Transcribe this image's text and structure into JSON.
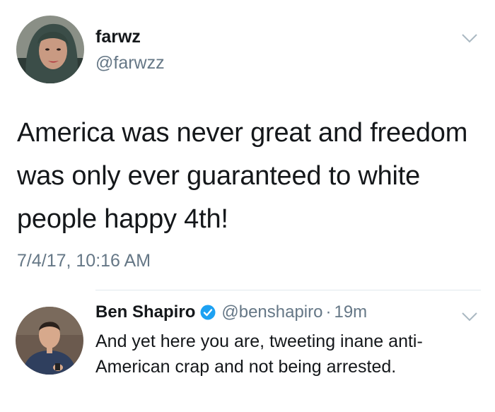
{
  "main_tweet": {
    "display_name": "farwz",
    "handle": "@farwzz",
    "text": "America was never great and freedom was only ever guaranteed to white people happy 4th!",
    "timestamp": "7/4/17, 10:16 AM",
    "avatar_icon": "profile-photo-woman-hijab"
  },
  "reply": {
    "display_name": "Ben Shapiro",
    "verified_icon": "verified-badge-icon",
    "handle": "@benshapiro",
    "separator": "·",
    "time": "19m",
    "text": "And yet here you are, tweeting inane anti-American crap and not being arrested.",
    "avatar_icon": "profile-photo-man-suit"
  },
  "colors": {
    "text_primary": "#14171a",
    "text_secondary": "#657786",
    "verified_blue": "#1da1f2",
    "divider": "#e1e8ed"
  }
}
